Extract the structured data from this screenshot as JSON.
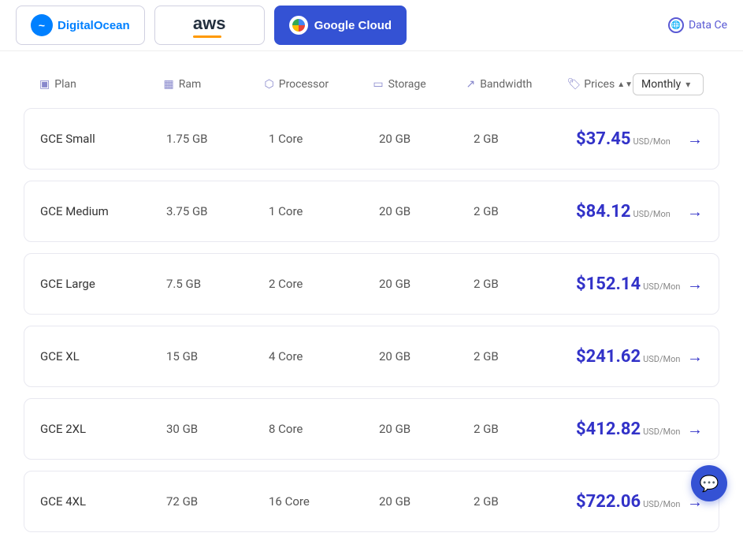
{
  "nav": {
    "providers": [
      {
        "id": "digitalocean",
        "label": "DigitalOcean",
        "active": false
      },
      {
        "id": "aws",
        "label": "aws",
        "active": false
      },
      {
        "id": "googlecloud",
        "label": "Google Cloud",
        "active": true
      }
    ],
    "data_center_label": "Data Ce"
  },
  "table": {
    "columns": [
      {
        "id": "plan",
        "label": "Plan",
        "icon": "plan-icon"
      },
      {
        "id": "ram",
        "label": "Ram",
        "icon": "ram-icon"
      },
      {
        "id": "processor",
        "label": "Processor",
        "icon": "processor-icon"
      },
      {
        "id": "storage",
        "label": "Storage",
        "icon": "storage-icon"
      },
      {
        "id": "bandwidth",
        "label": "Bandwidth",
        "icon": "bandwidth-icon"
      },
      {
        "id": "prices",
        "label": "Prices",
        "icon": "prices-icon",
        "sortable": true
      }
    ],
    "billing_period": "Monthly",
    "rows": [
      {
        "plan": "GCE Small",
        "ram": "1.75 GB",
        "processor": "1 Core",
        "storage": "20 GB",
        "bandwidth": "2 GB",
        "price": "$37.45",
        "unit": "USD/Mon"
      },
      {
        "plan": "GCE Medium",
        "ram": "3.75 GB",
        "processor": "1 Core",
        "storage": "20 GB",
        "bandwidth": "2 GB",
        "price": "$84.12",
        "unit": "USD/Mon"
      },
      {
        "plan": "GCE Large",
        "ram": "7.5 GB",
        "processor": "2 Core",
        "storage": "20 GB",
        "bandwidth": "2 GB",
        "price": "$152.14",
        "unit": "USD/Mon"
      },
      {
        "plan": "GCE XL",
        "ram": "15 GB",
        "processor": "4 Core",
        "storage": "20 GB",
        "bandwidth": "2 GB",
        "price": "$241.62",
        "unit": "USD/Mon"
      },
      {
        "plan": "GCE 2XL",
        "ram": "30 GB",
        "processor": "8 Core",
        "storage": "20 GB",
        "bandwidth": "2 GB",
        "price": "$412.82",
        "unit": "USD/Mon"
      },
      {
        "plan": "GCE 4XL",
        "ram": "72 GB",
        "processor": "16 Core",
        "storage": "20 GB",
        "bandwidth": "2 GB",
        "price": "$722.06",
        "unit": "USD/Mon"
      }
    ]
  }
}
